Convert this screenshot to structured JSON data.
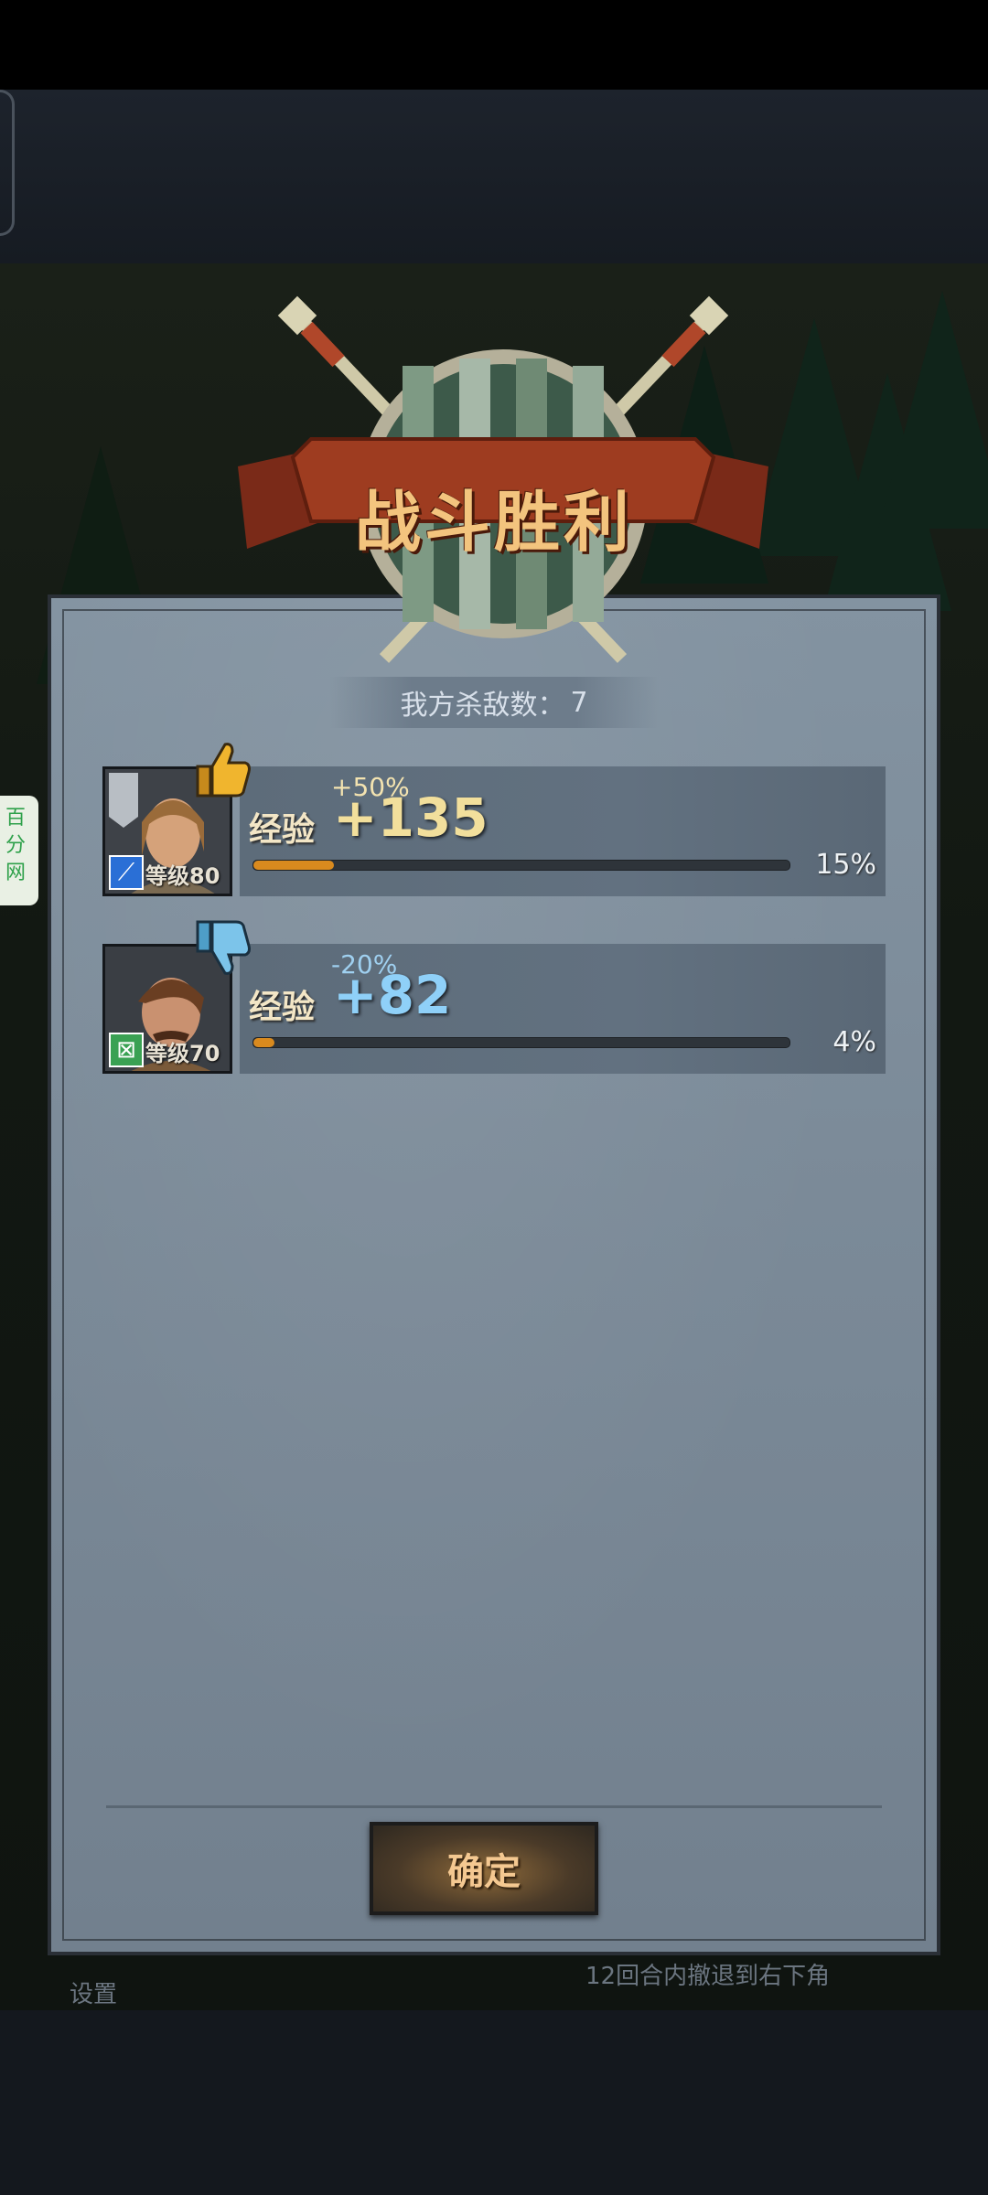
{
  "side_tab": {
    "label": "百分网"
  },
  "background": {
    "settings_label": "设置",
    "objective_text": "12回合内撤退到右下角"
  },
  "header": {
    "title": "战斗胜利"
  },
  "summary": {
    "kills_label": "我方杀敌数：",
    "kills_value": "7"
  },
  "heroes": [
    {
      "level_label": "等级80",
      "class_icon": "sword-icon",
      "class_color": "#2a6fd6",
      "rating_icon": "thumbs-up-icon",
      "bonus": "+50%",
      "bonus_color": "#f3e3b0",
      "exp_label": "经验",
      "exp_gain": "+135",
      "exp_color": "#f2df9c",
      "progress": 0.15,
      "progress_color": "#d98a1e",
      "progress_label": "15%"
    },
    {
      "level_label": "等级70",
      "class_icon": "crossed-box-icon",
      "class_color": "#3aa153",
      "rating_icon": "thumbs-down-icon",
      "bonus": "-20%",
      "bonus_color": "#9fd0f0",
      "exp_label": "经验",
      "exp_gain": "+82",
      "exp_color": "#8fd0f8",
      "progress": 0.04,
      "progress_color": "#d98a1e",
      "progress_label": "4%"
    }
  ],
  "actions": {
    "confirm_label": "确定"
  }
}
